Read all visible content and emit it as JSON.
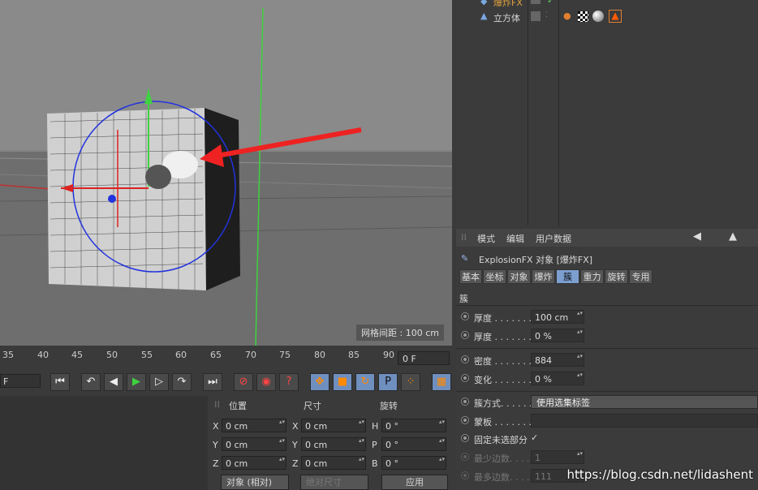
{
  "objects": [
    {
      "name": "爆炸FX",
      "color": "#e0a040"
    },
    {
      "name": "立方体",
      "color": "#dddddd"
    }
  ],
  "viewport": {
    "grid_spacing": "网格间距 : 100 cm"
  },
  "attr": {
    "menu": [
      "模式",
      "编辑",
      "用户数据"
    ],
    "object_title": "ExplosionFX 对象 [爆炸FX]",
    "tabs": [
      "基本",
      "坐标",
      "对象",
      "爆炸",
      "簇",
      "重力",
      "旋转",
      "专用"
    ],
    "active_tab": "簇",
    "section": "簇",
    "params": {
      "thickness": {
        "label": "厚度 . . . . . . .",
        "value": "100 cm"
      },
      "thickness_var": {
        "label": "厚度 . . . . . . .",
        "value": "0 %"
      },
      "density": {
        "label": "密度 . . . . . . .",
        "value": "884"
      },
      "variation": {
        "label": "变化 . . . . . . .",
        "value": "0 %"
      },
      "cluster_mode": {
        "label": "簇方式. . . . . .",
        "value": "使用选集标签"
      },
      "mask": {
        "label": "蒙板 . . . . . . .",
        "value": ""
      },
      "fix_unselected": {
        "label": "固定未选部分",
        "value": "✓"
      },
      "min_edges": {
        "label": "最少边数. . . . .",
        "value": "1"
      },
      "max_edges": {
        "label": "最多边数. . . . .",
        "value": "111"
      }
    }
  },
  "timeline": {
    "ticks": [
      "35",
      "40",
      "45",
      "50",
      "55",
      "60",
      "65",
      "70",
      "75",
      "80",
      "85",
      "90"
    ],
    "current_frame": "0 F",
    "left_field": "F"
  },
  "coords": {
    "headers": [
      "位置",
      "尺寸",
      "旋转"
    ],
    "pos": [
      {
        "axis": "X",
        "value": "0 cm"
      },
      {
        "axis": "Y",
        "value": "0 cm"
      },
      {
        "axis": "Z",
        "value": "0 cm"
      }
    ],
    "size": [
      {
        "axis": "X",
        "value": "0 cm"
      },
      {
        "axis": "Y",
        "value": "0 cm"
      },
      {
        "axis": "Z",
        "value": "0 cm"
      }
    ],
    "rot": [
      {
        "axis": "H",
        "value": "0 °"
      },
      {
        "axis": "P",
        "value": "0 °"
      },
      {
        "axis": "B",
        "value": "0 °"
      }
    ],
    "mode_select": "对象 (相对)",
    "size_select": "绝对尺寸",
    "apply": "应用"
  },
  "watermark": "https://blog.csdn.net/lidashent"
}
